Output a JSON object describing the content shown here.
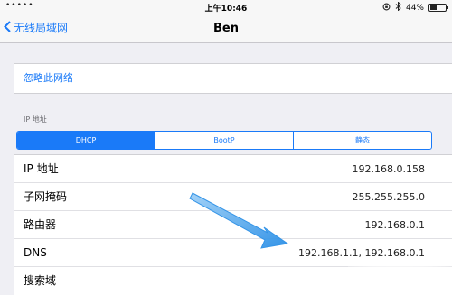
{
  "status_bar": {
    "time": "上午10:46",
    "battery_percent": "44%",
    "battery_level": 0.44,
    "icons": [
      "lock-rotation-icon",
      "bluetooth-icon",
      "battery-icon"
    ]
  },
  "nav": {
    "back_label": "无线局域网",
    "title": "Ben"
  },
  "forget_label": "忽略此网络",
  "ip_section_header": "IP 地址",
  "segments": [
    {
      "label": "DHCP",
      "active": true
    },
    {
      "label": "BootP",
      "active": false
    },
    {
      "label": "静态",
      "active": false
    }
  ],
  "details": [
    {
      "label": "IP 地址",
      "value": "192.168.0.158"
    },
    {
      "label": "子网掩码",
      "value": "255.255.255.0"
    },
    {
      "label": "路由器",
      "value": "192.168.0.1"
    },
    {
      "label": "DNS",
      "value": "192.168.1.1, 192.168.0.1"
    },
    {
      "label": "搜索域",
      "value": ""
    }
  ],
  "colors": {
    "accent": "#1a7af8",
    "arrow": "#2a8fe6",
    "background": "#efeff4"
  }
}
